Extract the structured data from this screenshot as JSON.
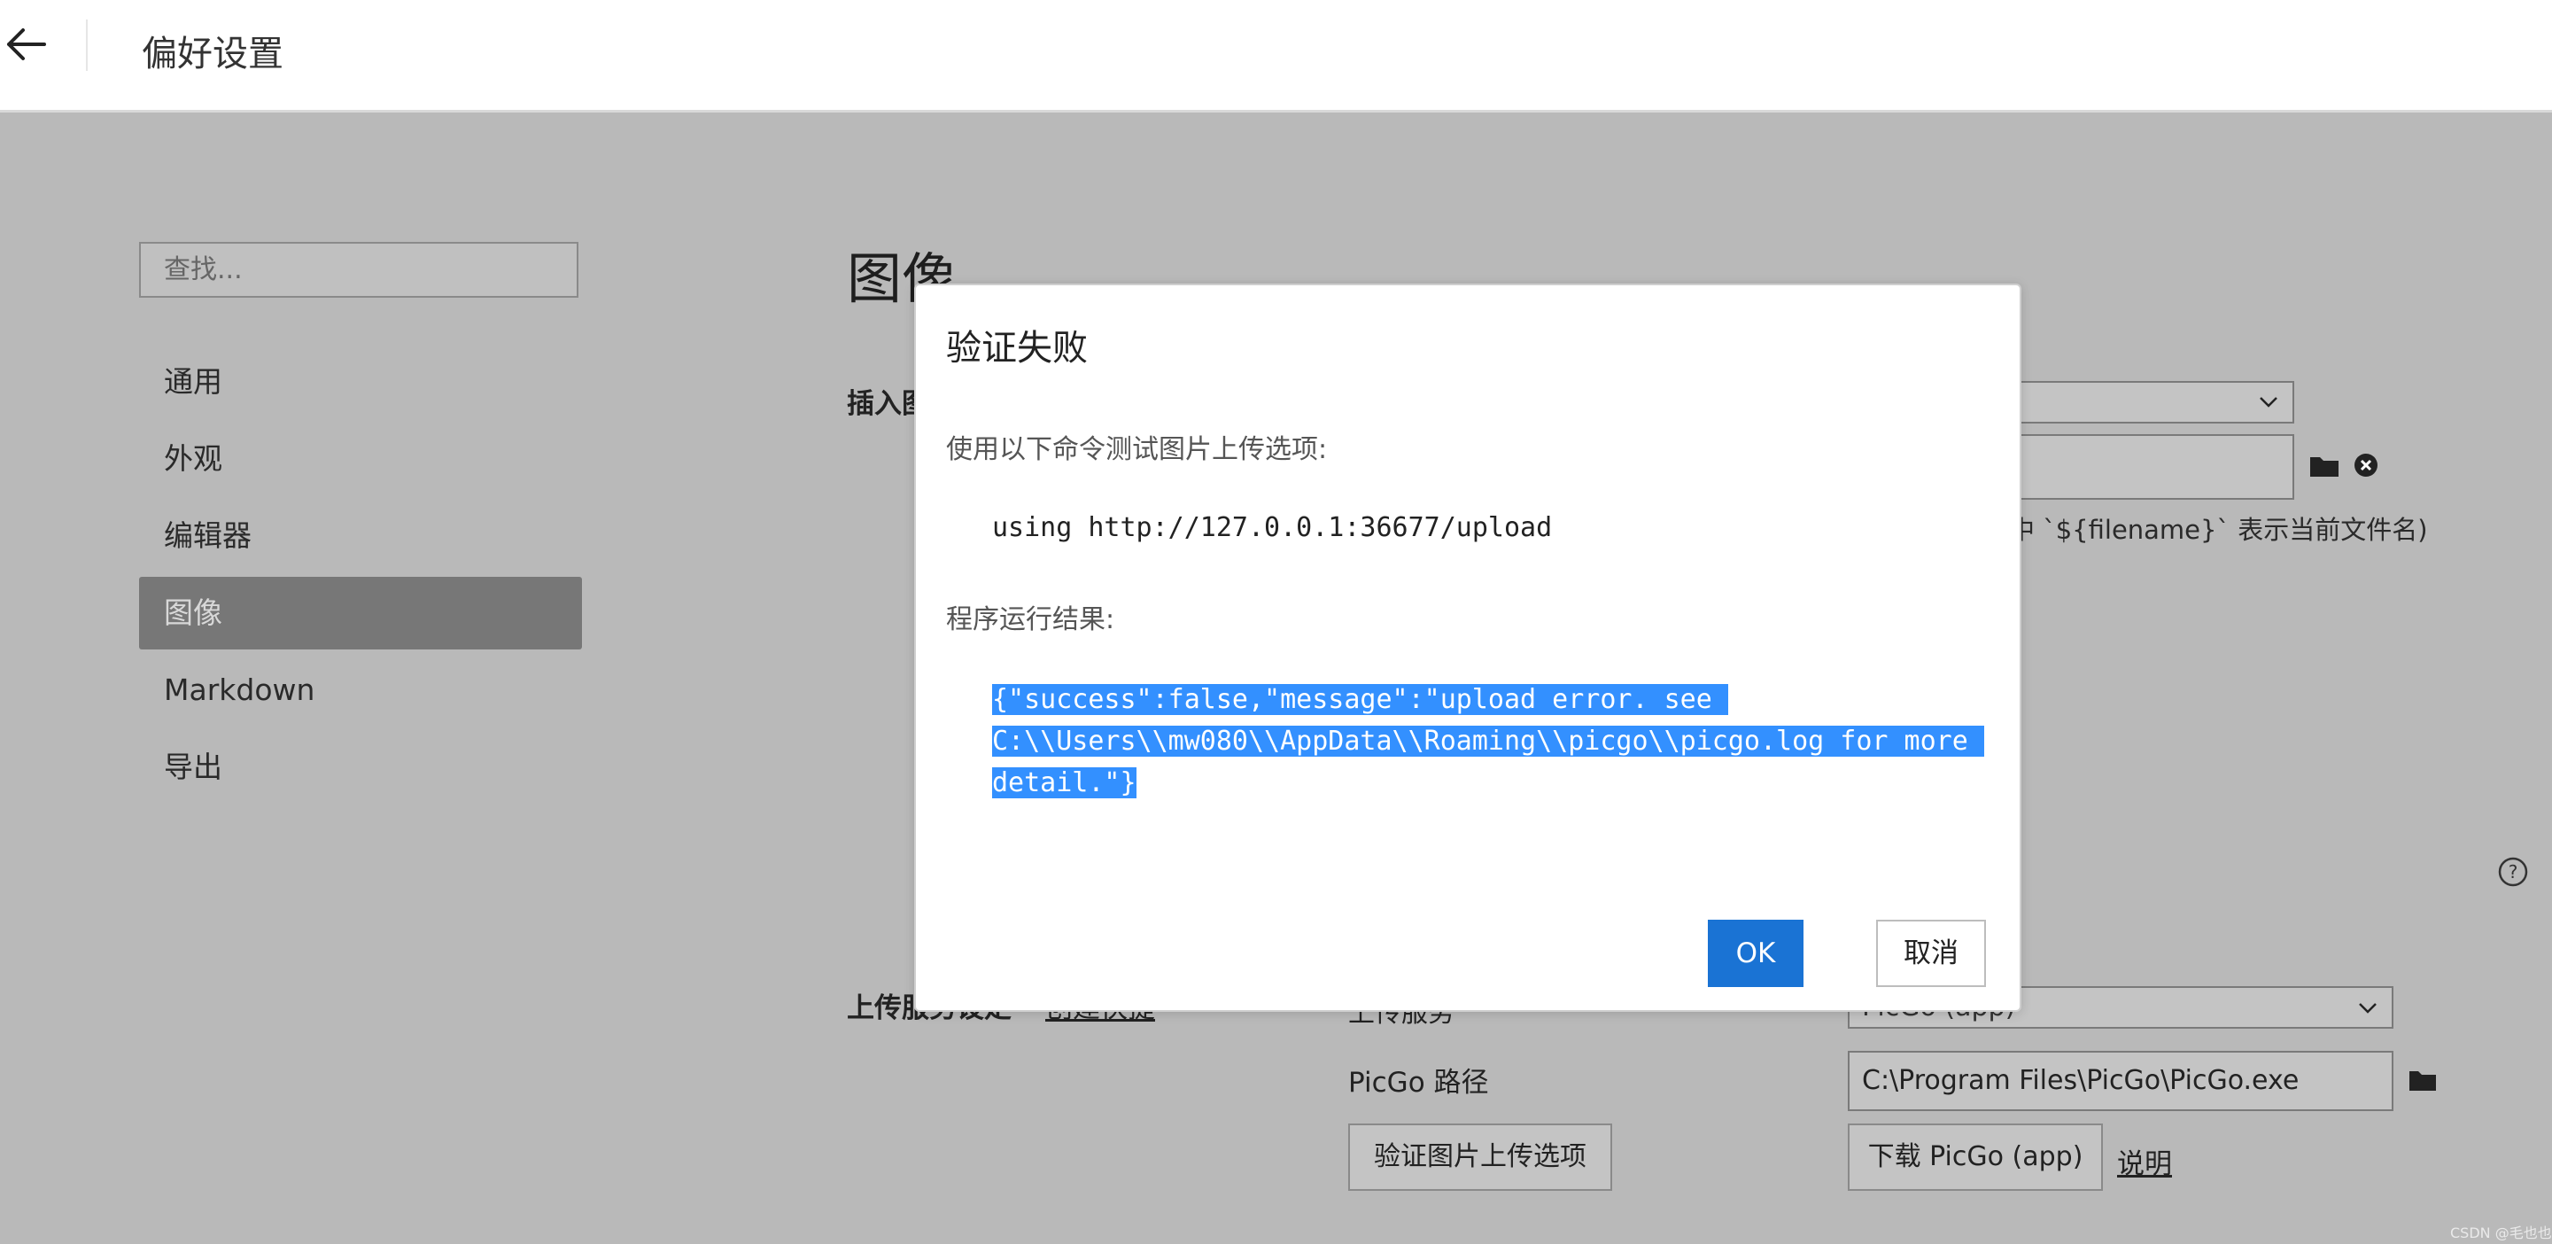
{
  "header": {
    "title": "偏好设置",
    "back_icon": "arrow-left-icon"
  },
  "sidebar": {
    "search_placeholder": "查找...",
    "items": [
      {
        "label": "通用",
        "active": false
      },
      {
        "label": "外观",
        "active": false
      },
      {
        "label": "编辑器",
        "active": false
      },
      {
        "label": "图像",
        "active": true
      },
      {
        "label": "Markdown",
        "active": false
      },
      {
        "label": "导出",
        "active": false
      }
    ]
  },
  "main": {
    "section_title": "图像",
    "insert_heading_partial": "插入图",
    "hint_partial": "中 `${filename}` 表示当前文件名)",
    "upload": {
      "heading_partial": "上传服务设定",
      "link_partial": "创建快捷",
      "service_label": "上传服务",
      "service_value": "PicGo (app)",
      "picgo_path_label": "PicGo 路径",
      "picgo_path_value": "C:\\Program Files\\PicGo\\PicGo.exe",
      "verify_button": "验证图片上传选项",
      "download_button": "下载 PicGo (app)",
      "explain_link": "说明"
    },
    "watermark": "CSDN @毛也也"
  },
  "dialog": {
    "title": "验证失败",
    "command_label": "使用以下命令测试图片上传选项:",
    "command": "using http://127.0.0.1:36677/upload",
    "result_label": "程序运行结果:",
    "result_lines": [
      "{\"success\":false,\"message\":\"upload error. see ",
      "C:\\\\Users\\\\mw080\\\\AppData\\\\Roaming\\\\picgo\\\\picgo.log for more ",
      "detail.\"}"
    ],
    "ok_button": "OK",
    "cancel_button": "取消"
  },
  "colors": {
    "overlay_bg": "#b9b9b9",
    "active_nav_bg": "#777777",
    "primary_button": "#1a73d4",
    "selection_highlight": "#3390ff"
  }
}
